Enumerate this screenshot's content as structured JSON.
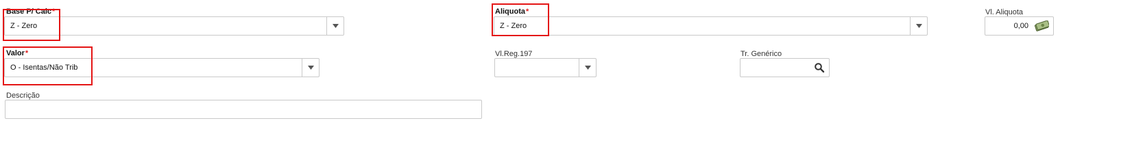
{
  "fields": {
    "base_calc": {
      "label": "Base P/ Calc",
      "required_mark": "*",
      "value": "Z - Zero"
    },
    "aliquota": {
      "label": "Aliquota",
      "required_mark": "*",
      "value": "Z - Zero"
    },
    "vl_aliquota": {
      "label": "Vl. Aliquota",
      "value": "0,00"
    },
    "valor": {
      "label": "Valor",
      "required_mark": "*",
      "value": "O - Isentas/Não Trib"
    },
    "vl_reg_197": {
      "label": "Vl.Reg.197",
      "value": ""
    },
    "tr_generico": {
      "label": "Tr. Genérico",
      "value": ""
    },
    "descricao": {
      "label": "Descrição",
      "value": ""
    }
  },
  "icons": {
    "dropdown": "chevron-down-icon",
    "search": "search-icon",
    "money": "money-icon"
  },
  "colors": {
    "highlight": "#e41414",
    "required": "#e02020",
    "border": "#c9c9c9"
  }
}
